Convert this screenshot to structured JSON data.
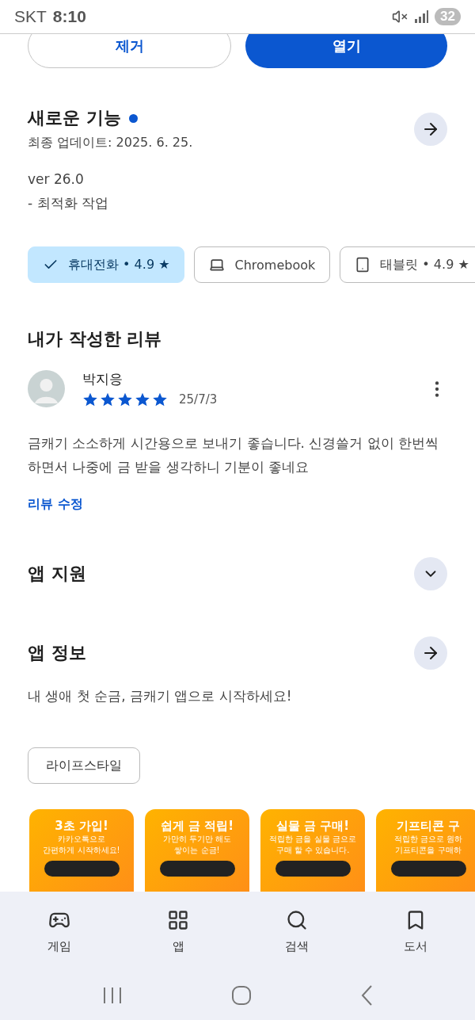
{
  "status_bar": {
    "carrier": "SKT",
    "time": "8:10",
    "battery": "32"
  },
  "actions": [
    {
      "label": "제거",
      "kind": "outline"
    },
    {
      "label": "열기",
      "kind": "filled"
    }
  ],
  "whats_new": {
    "title": "새로운 기능",
    "updated": "최종 업데이트: 2025. 6. 25.",
    "version": "ver 26.0",
    "note": "- 최적화 작업",
    "new_dot": true
  },
  "devices": [
    {
      "label": "휴대전화 • 4.9 ★",
      "kind": "phone",
      "selected": true
    },
    {
      "label": "Chromebook",
      "kind": "laptop",
      "selected": false
    },
    {
      "label": "태블릿 • 4.9 ★",
      "kind": "tablet",
      "selected": false
    }
  ],
  "my_review": {
    "title": "내가 작성한 리뷰",
    "author": "박지응",
    "stars": 5,
    "date": "25/7/3",
    "text": "금캐기 소소하게 시간용으로 보내기 좋습니다. 신경쓸거 없이 한번씩 하면서 나중에 금 받을 생각하니 기분이 좋네요",
    "edit_link": "리뷰 수정"
  },
  "sections": [
    {
      "title": "앱 지원",
      "kind": "expand",
      "expanded": false
    },
    {
      "title": "앱 정보",
      "kind": "arrow"
    }
  ],
  "about": "내 생애 첫 순금, 금캐기 앱으로 시작하세요!",
  "category": "라이프스타일",
  "screenshots": [
    {
      "headline": "3초 가입!",
      "lines": [
        "카카오톡으로",
        "간편하게 시작하세요!"
      ]
    },
    {
      "headline": "쉽게 금 적립!",
      "lines": [
        "가만히 두기만 해도",
        "쌓이는 순금!"
      ]
    },
    {
      "headline": "실물 금 구매!",
      "lines": [
        "적립한 금을 실물 금으로",
        "구매 할 수 있습니다."
      ]
    },
    {
      "headline": "기프티콘 구",
      "lines": [
        "적립한 금으로 원하",
        "기프티콘을 구매하"
      ]
    }
  ],
  "bottom_nav": [
    {
      "label": "게임",
      "kind": "games",
      "selected": false
    },
    {
      "label": "앱",
      "kind": "apps",
      "selected": false
    },
    {
      "label": "검색",
      "kind": "search",
      "selected": false
    },
    {
      "label": "도서",
      "kind": "books",
      "selected": false
    }
  ]
}
